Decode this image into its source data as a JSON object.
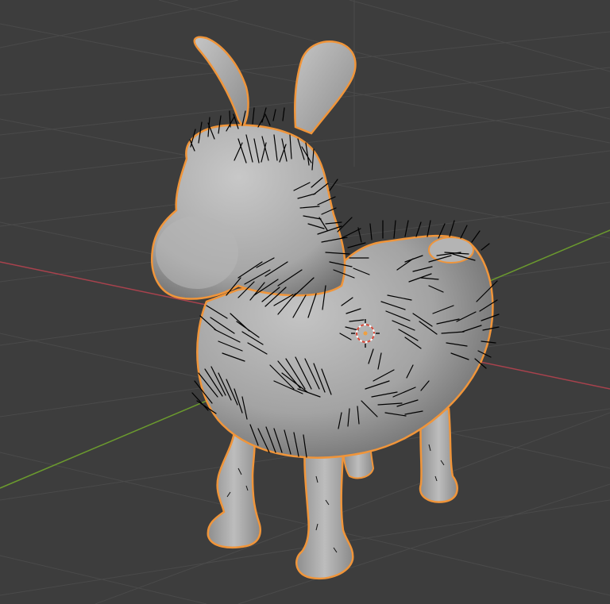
{
  "app": "Blender",
  "viewport": {
    "shading": "solid",
    "selected_object": "fuzzy-creature",
    "selection_outline_color": "#f0953a",
    "background_color": "#3d3d3d",
    "grid_color": "#4c4c4c",
    "x_axis_color": "#b0414d",
    "y_axis_color": "#6e9a30",
    "object_color": "#a9a9a9",
    "hair_color": "#000000",
    "icons": [
      "origin-3d-cursor-icon"
    ]
  }
}
